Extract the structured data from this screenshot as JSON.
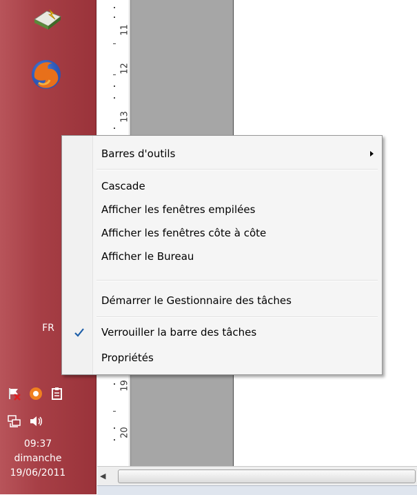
{
  "taskbar": {
    "apps": [
      {
        "icon": "folder-icon"
      },
      {
        "icon": "firefox-icon"
      }
    ],
    "language": "FR",
    "tray_row1": [
      "flag-error-icon",
      "avast-icon",
      "clipboard-icon"
    ],
    "tray_row2": [
      "network-icon",
      "volume-icon"
    ],
    "clock": {
      "time": "09:37",
      "day": "dimanche",
      "date": "19/06/2011"
    }
  },
  "ruler": {
    "labels": [
      "11",
      "12",
      "13",
      "19",
      "20"
    ]
  },
  "context_menu": {
    "items": [
      {
        "label": "Barres d'outils",
        "has_submenu": true
      },
      {
        "label": "Cascade"
      },
      {
        "label": "Afficher les fenêtres empilées"
      },
      {
        "label": "Afficher les fenêtres côte à côte"
      },
      {
        "label": "Afficher le Bureau"
      },
      {
        "label": "Démarrer le Gestionnaire des tâches"
      },
      {
        "label": "Verrouiller la barre des tâches",
        "checked": true
      },
      {
        "label": "Propriétés"
      }
    ]
  },
  "colors": {
    "taskbar": "#a73f46",
    "menu_bg": "#f5f5f5",
    "check": "#1c5ea8"
  }
}
